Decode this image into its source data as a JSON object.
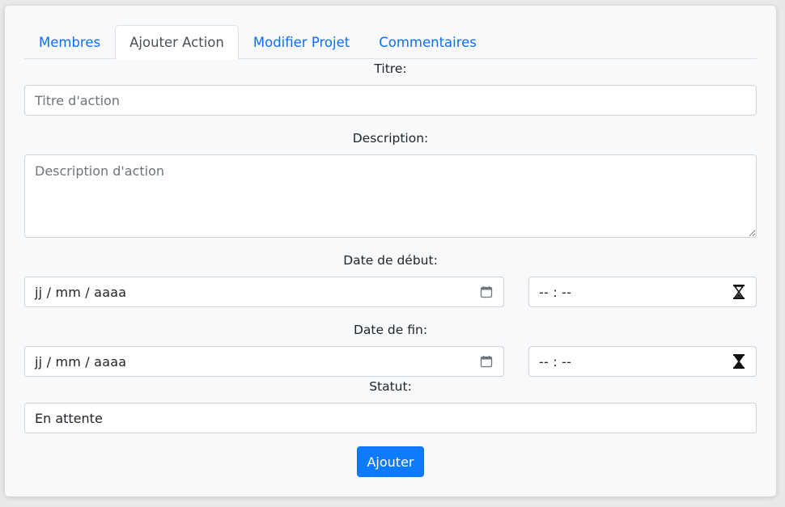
{
  "tabs": [
    {
      "label": "Membres"
    },
    {
      "label": "Ajouter Action"
    },
    {
      "label": "Modifier Projet"
    },
    {
      "label": "Commentaires"
    }
  ],
  "form": {
    "title_label": "Titre:",
    "title_placeholder": "Titre d'action",
    "description_label": "Description:",
    "description_placeholder": "Description d'action",
    "start_label": "Date de début:",
    "start_date": "jj / mm / aaaa",
    "start_time": "-- : --",
    "end_label": "Date de fin:",
    "end_date": "jj / mm / aaaa",
    "end_time": "-- : --",
    "status_label": "Statut:",
    "status_value": "En attente",
    "submit_label": "Ajouter"
  },
  "colors": {
    "accent": "#0d6efd",
    "button": "#0d7bfd",
    "border": "#ced4da"
  },
  "icons": [
    "calendar-icon",
    "hourglass-icon"
  ]
}
